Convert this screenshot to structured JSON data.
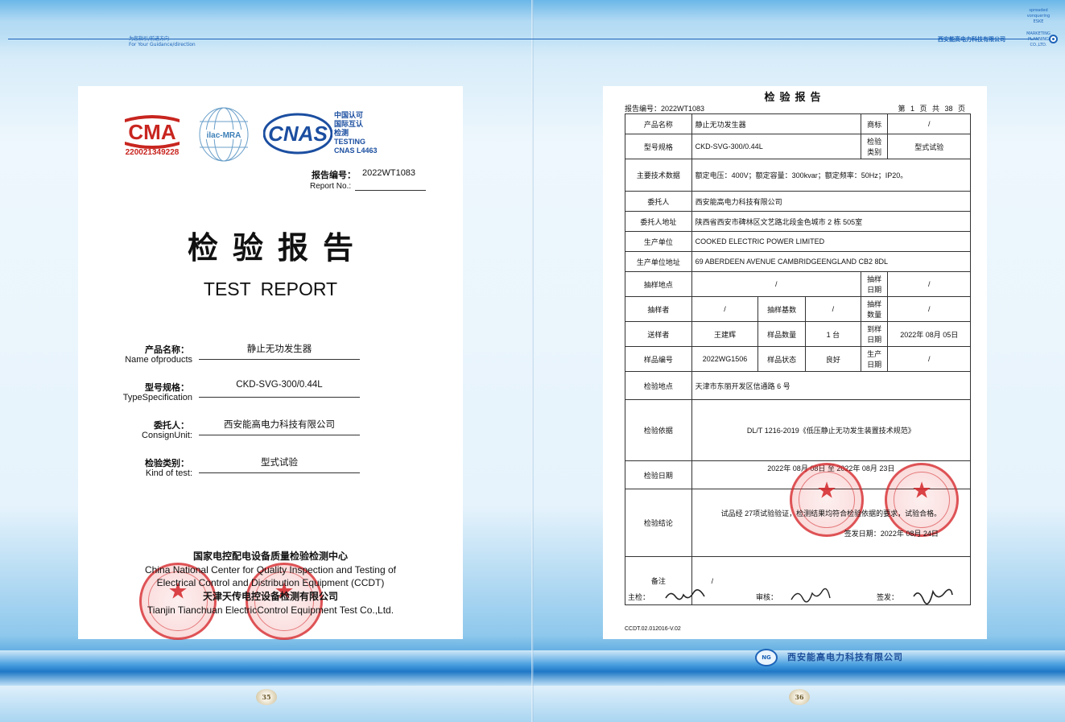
{
  "header": {
    "left_label_cn": "为您指引/前进方向",
    "left_label_en": "For Your Guidance/direction",
    "right_label_cn": "西安能高电力科技有限公司",
    "side_text": [
      "spreaded",
      "vonquering",
      "ESKE",
      "MARKETING",
      "PLANNING",
      "CO.,LTD."
    ]
  },
  "left_page": {
    "cma_number": "220021349228",
    "cma_text": "CMA",
    "ilac_text": "ilac-MRA",
    "cnas_text": "CNAS",
    "cnas_lines": [
      "中国认可",
      "国际互认",
      "检测",
      "TESTING",
      "CNAS L4463"
    ],
    "report_label_cn": "报告编号：",
    "report_value": "2022WT1083",
    "report_label_en": "Report No.:",
    "title_cn": "检验报告",
    "title_en": "TEST  REPORT",
    "fields": [
      {
        "label_cn": "产品名称：",
        "label_en": "Name ofproducts",
        "value": "静止无功发生器"
      },
      {
        "label_cn": "型号规格：",
        "label_en": "TypeSpecification",
        "value": "CKD-SVG-300/0.44L"
      },
      {
        "label_cn": "委托人：",
        "label_en": "ConsignUnit:",
        "value": "西安能高电力科技有限公司"
      },
      {
        "label_cn": "检验类别：",
        "label_en": "Kind of test:",
        "value": "型式试验"
      }
    ],
    "footer_lines": [
      {
        "text": "国家电控配电设备质量检验检测中心",
        "kind": "cn"
      },
      {
        "text": "China National Center for Quality Inspection and Testing of",
        "kind": "en"
      },
      {
        "text": "Electrical Control and Distribution Equipment (CCDT)",
        "kind": "en"
      },
      {
        "text": "天津天传电控设备检测有限公司",
        "kind": "cn"
      },
      {
        "text": "Tianjin Tianchuan ElectricControl Equipment Test Co.,Ltd.",
        "kind": "en"
      }
    ],
    "page_number": "35"
  },
  "right_page": {
    "title": "检验报告",
    "report_no": "报告编号：2022WT1083",
    "page_info": "第 1 页  共 38 页",
    "rows": {
      "product_name_label": "产品名称",
      "product_name": "静止无功发生器",
      "brand_label": "商标",
      "brand": "/",
      "model_label": "型号规格",
      "model": "CKD-SVG-300/0.44L",
      "test_type_label": "检验类别",
      "test_type": "型式试验",
      "tech_label": "主要技术数据",
      "tech": "额定电压：400V；额定容量：300kvar；额定频率：50Hz；IP20。",
      "client_label": "委托人",
      "client": "西安能高电力科技有限公司",
      "client_addr_label": "委托人地址",
      "client_addr": "陕西省西安市碑林区文艺路北段金色城市 2 栋 505室",
      "maker_label": "生产单位",
      "maker": "COOKED ELECTRIC POWER LIMITED",
      "maker_addr_label": "生产单位地址",
      "maker_addr": "69 ABERDEEN AVENUE CAMBRIDGEENGLAND CB2 8DL",
      "sample_site_label": "抽样地点",
      "sample_site": "/",
      "sample_date_label": "抽样日期",
      "sample_date": "/",
      "sampler_label": "抽样者",
      "sampler": "/",
      "sample_base_label": "抽样基数",
      "sample_base": "/",
      "sample_qty_label": "抽样数量",
      "sample_qty": "/",
      "sender_label": "送样者",
      "sender": "王建辉",
      "sample_count_label": "样品数量",
      "sample_count": "1 台",
      "arrival_date_label": "到样日期",
      "arrival_date": "2022年 08月 05日",
      "sample_no_label": "样品编号",
      "sample_no": "2022WG1506",
      "sample_state_label": "样品状态",
      "sample_state": "良好",
      "prod_date_label": "生产日期",
      "prod_date": "/",
      "test_site_label": "检验地点",
      "test_site": "天津市东丽开发区信通路 6 号",
      "basis_label": "检验依据",
      "basis": "DL/T 1216-2019《低压静止无功发生装置技术规范》",
      "test_date_label": "检验日期",
      "test_date": "2022年 08月 08日 至 2022年 08月 23日",
      "conclusion_label": "检验结论",
      "conclusion": "试品经 27项试验验证，检测结果均符合检验依据的要求，试验合格。",
      "issue_date": "签发日期：2022年 08月 24日",
      "remark_label": "备注",
      "remark": "/"
    },
    "sign_chief_label": "主检：",
    "sign_review_label": "审核：",
    "sign_issue_label": "签发：",
    "doc_code": "CCDT.02.012016-V.02",
    "company_logo": "NG",
    "company_name": "西安能高电力科技有限公司",
    "page_number": "36"
  }
}
